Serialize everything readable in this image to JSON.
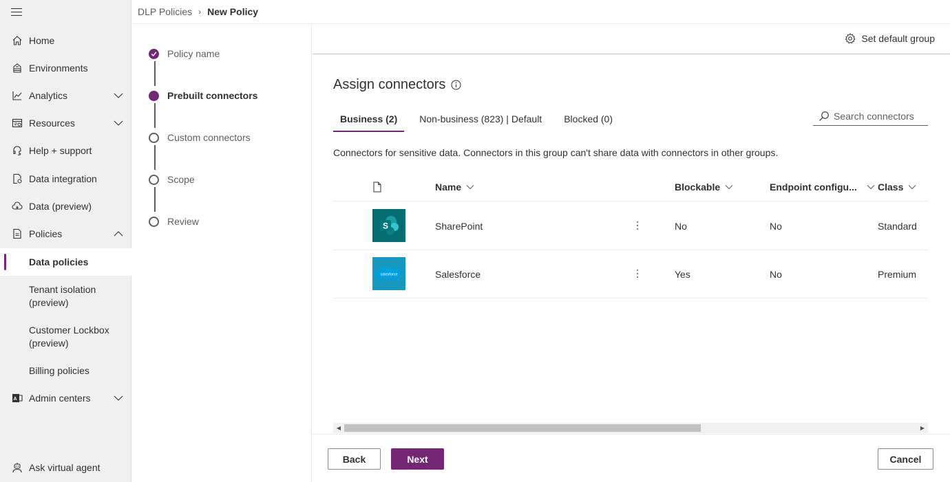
{
  "nav": {
    "items": [
      {
        "label": "Home",
        "icon": "home-icon"
      },
      {
        "label": "Environments",
        "icon": "environments-icon"
      },
      {
        "label": "Analytics",
        "icon": "analytics-icon"
      },
      {
        "label": "Resources",
        "icon": "resources-icon"
      },
      {
        "label": "Help + support",
        "icon": "headset-icon"
      },
      {
        "label": "Data integration",
        "icon": "data-integration-icon"
      },
      {
        "label": "Data (preview)",
        "icon": "cloud-data-icon"
      },
      {
        "label": "Policies",
        "icon": "policies-icon"
      }
    ],
    "sub_items": [
      {
        "label": "Data policies",
        "active": true
      },
      {
        "label": "Tenant isolation (preview)"
      },
      {
        "label": "Customer Lockbox (preview)"
      },
      {
        "label": "Billing policies"
      }
    ],
    "admin_centers": "Admin centers",
    "ask_agent": "Ask virtual agent"
  },
  "breadcrumb": {
    "parent": "DLP Policies",
    "current": "New Policy"
  },
  "steps": [
    {
      "label": "Policy name",
      "state": "done"
    },
    {
      "label": "Prebuilt connectors",
      "state": "current"
    },
    {
      "label": "Custom connectors",
      "state": "todo"
    },
    {
      "label": "Scope",
      "state": "todo"
    },
    {
      "label": "Review",
      "state": "todo"
    }
  ],
  "toolbar": {
    "set_default_group": "Set default group"
  },
  "main": {
    "title": "Assign connectors",
    "tabs": [
      "Business (2)",
      "Non-business (823) | Default",
      "Blocked (0)"
    ],
    "search_placeholder": "Search connectors",
    "description": "Connectors for sensitive data. Connectors in this group can't share data with connectors in other groups."
  },
  "table": {
    "columns": {
      "name": "Name",
      "blockable": "Blockable",
      "endpoint": "Endpoint configu...",
      "class": "Class"
    },
    "rows": [
      {
        "name": "SharePoint",
        "blockable": "No",
        "endpoint": "No",
        "class": "Standard",
        "logo_color": "#036c70",
        "logo_text": "S"
      },
      {
        "name": "Salesforce",
        "blockable": "Yes",
        "endpoint": "No",
        "class": "Premium",
        "logo_color": "#1798c1",
        "logo_text": "salesforce"
      }
    ]
  },
  "footer": {
    "back": "Back",
    "next": "Next",
    "cancel": "Cancel"
  },
  "colors": {
    "accent": "#742774"
  }
}
